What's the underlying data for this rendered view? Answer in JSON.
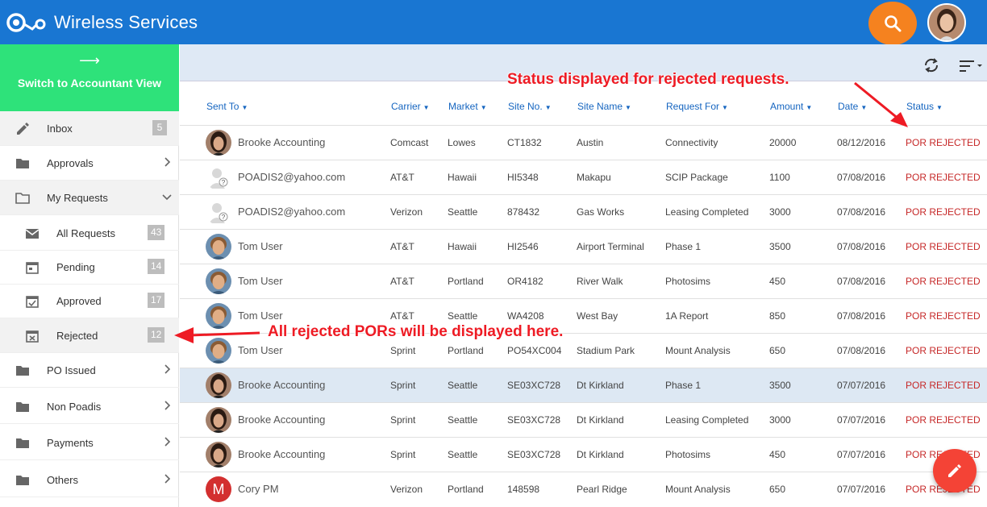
{
  "app": {
    "title": "Wireless Services"
  },
  "header": {
    "search_icon": "search-icon",
    "avatar": "user-avatar"
  },
  "sidebar": {
    "switch_label": "Switch to Accountant View",
    "items": [
      {
        "label": "Inbox",
        "badge": "5",
        "icon": "pencil-icon"
      },
      {
        "label": "Approvals",
        "icon": "folder-icon"
      },
      {
        "label": "My Requests",
        "icon": "folder-open-icon"
      },
      {
        "label": "All Requests",
        "badge": "43",
        "icon": "mail-icon"
      },
      {
        "label": "Pending",
        "badge": "14",
        "icon": "calendar-icon"
      },
      {
        "label": "Approved",
        "badge": "17",
        "icon": "calendar-check-icon"
      },
      {
        "label": "Rejected",
        "badge": "12",
        "icon": "calendar-x-icon"
      },
      {
        "label": "PO Issued",
        "icon": "folder-icon"
      },
      {
        "label": "Non Poadis",
        "icon": "folder-icon"
      },
      {
        "label": "Payments",
        "icon": "folder-icon"
      },
      {
        "label": "Others",
        "icon": "folder-icon"
      }
    ]
  },
  "table": {
    "columns": [
      "Sent To",
      "Carrier",
      "Market",
      "Site No.",
      "Site Name",
      "Request For",
      "Amount",
      "Date",
      "Status"
    ],
    "rows": [
      {
        "avatar": "woman",
        "sent_to": "Brooke Accounting",
        "carrier": "Comcast",
        "market": "Lowes",
        "site_no": "CT1832",
        "site_name": "Austin",
        "request_for": "Connectivity",
        "amount": "20000",
        "date": "08/12/2016",
        "status": "POR REJECTED"
      },
      {
        "avatar": "unknown",
        "sent_to": "POADIS2@yahoo.com",
        "carrier": "AT&T",
        "market": "Hawaii",
        "site_no": "HI5348",
        "site_name": "Makapu",
        "request_for": "SCIP Package",
        "amount": "1100",
        "date": "07/08/2016",
        "status": "POR REJECTED"
      },
      {
        "avatar": "unknown",
        "sent_to": "POADIS2@yahoo.com",
        "carrier": "Verizon",
        "market": "Seattle",
        "site_no": "878432",
        "site_name": "Gas Works",
        "request_for": "Leasing Completed",
        "amount": "3000",
        "date": "07/08/2016",
        "status": "POR REJECTED"
      },
      {
        "avatar": "man",
        "sent_to": "Tom User",
        "carrier": "AT&T",
        "market": "Hawaii",
        "site_no": "HI2546",
        "site_name": "Airport Terminal",
        "request_for": "Phase 1",
        "amount": "3500",
        "date": "07/08/2016",
        "status": "POR REJECTED"
      },
      {
        "avatar": "man",
        "sent_to": "Tom User",
        "carrier": "AT&T",
        "market": "Portland",
        "site_no": "OR4182",
        "site_name": "River Walk",
        "request_for": "Photosims",
        "amount": "450",
        "date": "07/08/2016",
        "status": "POR REJECTED"
      },
      {
        "avatar": "man",
        "sent_to": "Tom User",
        "carrier": "AT&T",
        "market": "Seattle",
        "site_no": "WA4208",
        "site_name": "West Bay",
        "request_for": "1A Report",
        "amount": "850",
        "date": "07/08/2016",
        "status": "POR REJECTED"
      },
      {
        "avatar": "man",
        "sent_to": "Tom User",
        "carrier": "Sprint",
        "market": "Portland",
        "site_no": "PO54XC004",
        "site_name": "Stadium Park",
        "request_for": "Mount Analysis",
        "amount": "650",
        "date": "07/08/2016",
        "status": "POR REJECTED"
      },
      {
        "avatar": "woman",
        "sent_to": "Brooke Accounting",
        "carrier": "Sprint",
        "market": "Seattle",
        "site_no": "SE03XC728",
        "site_name": "Dt Kirkland",
        "request_for": "Phase 1",
        "amount": "3500",
        "date": "07/07/2016",
        "status": "POR REJECTED"
      },
      {
        "avatar": "woman",
        "sent_to": "Brooke Accounting",
        "carrier": "Sprint",
        "market": "Seattle",
        "site_no": "SE03XC728",
        "site_name": "Dt Kirkland",
        "request_for": "Leasing Completed",
        "amount": "3000",
        "date": "07/07/2016",
        "status": "POR REJECTED"
      },
      {
        "avatar": "woman",
        "sent_to": "Brooke Accounting",
        "carrier": "Sprint",
        "market": "Seattle",
        "site_no": "SE03XC728",
        "site_name": "Dt Kirkland",
        "request_for": "Photosims",
        "amount": "450",
        "date": "07/07/2016",
        "status": "POR REJECTED"
      },
      {
        "avatar": "letter",
        "initial": "M",
        "sent_to": "Cory PM",
        "carrier": "Verizon",
        "market": "Portland",
        "site_no": "148598",
        "site_name": "Pearl Ridge",
        "request_for": "Mount Analysis",
        "amount": "650",
        "date": "07/07/2016",
        "status": "POR REJECTED"
      }
    ]
  },
  "annotations": {
    "status_note": "Status displayed for rejected requests.",
    "rejected_note": "All rejected PORs will be displayed here."
  },
  "colors": {
    "header": "#1976d2",
    "switch": "#2ee27a",
    "search": "#f5821f",
    "status": "#c62828",
    "annotation": "#ee1b24",
    "fab": "#f44336"
  }
}
